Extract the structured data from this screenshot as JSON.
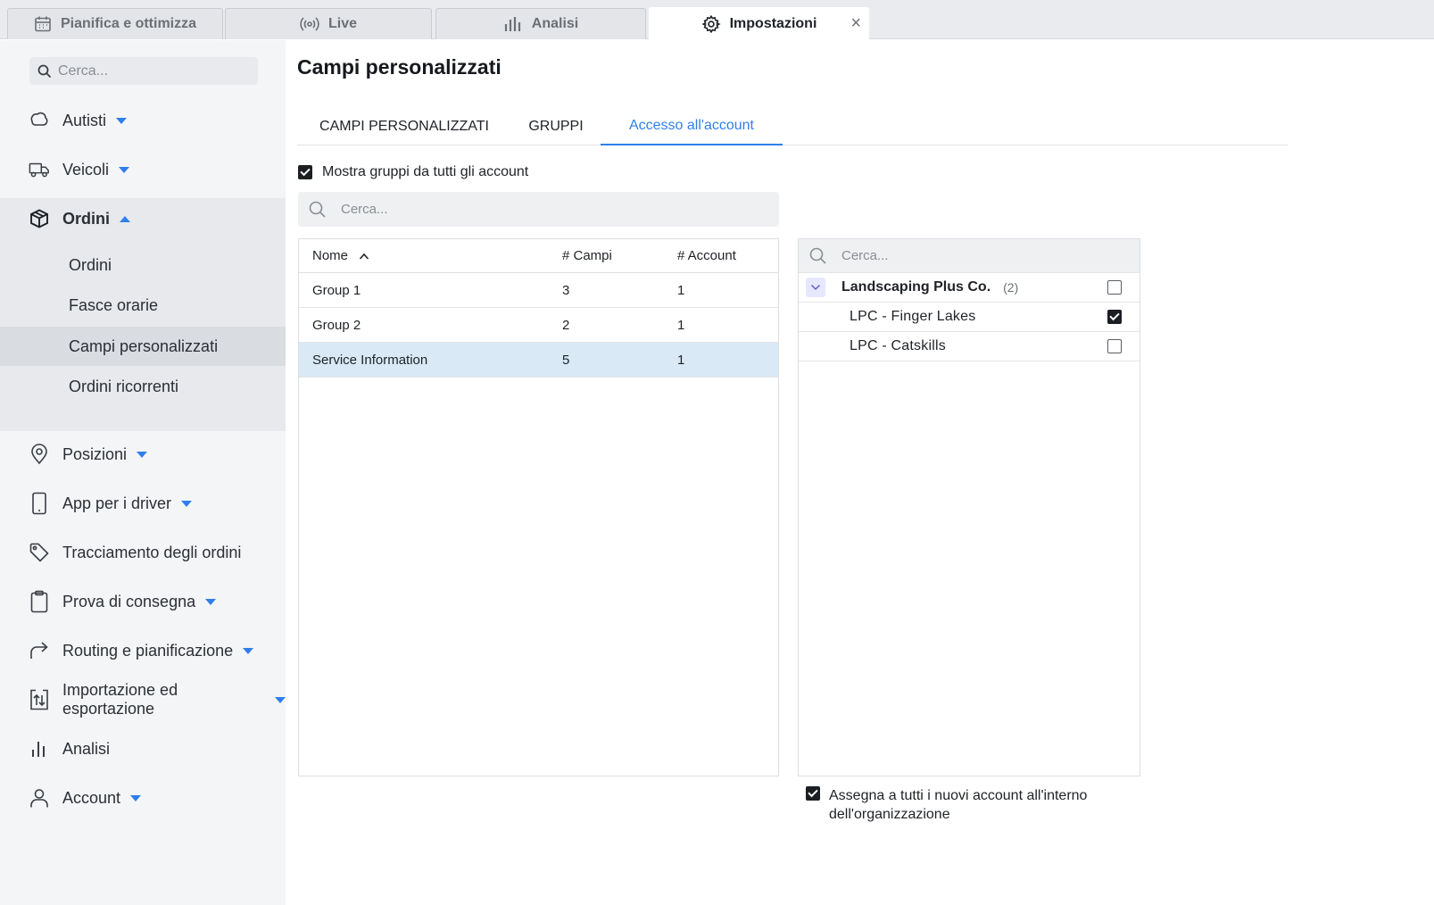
{
  "tabs": [
    {
      "label": "Pianifica e ottimizza",
      "icon": "calendar-icon"
    },
    {
      "label": "Live",
      "icon": "broadcast-icon"
    },
    {
      "label": "Analisi",
      "icon": "bar-chart-icon"
    },
    {
      "label": "Impostazioni",
      "icon": "gear-icon",
      "active": true
    }
  ],
  "tab_close": "×",
  "sidebar": {
    "search_placeholder": "Cerca...",
    "items": [
      {
        "label": "Autisti",
        "icon": "drivers-icon",
        "caret": true
      },
      {
        "label": "Veicoli",
        "icon": "truck-icon",
        "caret": true
      },
      {
        "label": "Ordini",
        "icon": "box-icon",
        "caret": "up",
        "expanded": true
      },
      {
        "label": "Posizioni",
        "icon": "location-pin-icon",
        "caret": true
      },
      {
        "label": "App per i driver",
        "icon": "phone-icon",
        "caret": true
      },
      {
        "label": "Tracciamento degli ordini",
        "icon": "tag-icon",
        "caret": false
      },
      {
        "label": "Prova di consegna",
        "icon": "clipboard-icon",
        "caret": true
      },
      {
        "label": "Routing e pianificazione",
        "icon": "route-arrow-icon",
        "caret": true
      },
      {
        "label": "Importazione ed esportazione",
        "icon": "import-export-icon",
        "caret": true
      },
      {
        "label": "Analisi",
        "icon": "bar-chart-icon",
        "caret": false
      },
      {
        "label": "Account",
        "icon": "user-icon",
        "caret": true
      }
    ],
    "sub_items": [
      "Ordini",
      "Fasce orarie",
      "Campi personalizzati",
      "Ordini ricorrenti"
    ],
    "selected_sub_item": "Campi personalizzati"
  },
  "main": {
    "title": "Campi personalizzati",
    "subtabs": [
      "CAMPI PERSONALIZZATI",
      "GRUPPI",
      "Accesso all'account"
    ],
    "active_subtab": "Accesso all'account",
    "show_all_label": "Mostra gruppi da tutti gli account",
    "show_all_checked": true,
    "search_placeholder": "Cerca...",
    "table": {
      "columns": [
        "Nome",
        "# Campi",
        "# Account"
      ],
      "rows": [
        [
          "Group 1",
          "3",
          "1"
        ],
        [
          "Group 2",
          "2",
          "1"
        ],
        [
          "Service Information",
          "5",
          "1"
        ]
      ],
      "selected_row": "Service Information"
    },
    "accounts": {
      "search_placeholder": "Cerca...",
      "group_name": "Landscaping Plus Co.",
      "group_count": "(2)",
      "group_checked": false,
      "children": [
        {
          "label": "LPC - Finger Lakes",
          "checked": true
        },
        {
          "label": "LPC - Catskills",
          "checked": false
        }
      ]
    },
    "assign_label": "Assegna a tutti i nuovi account all'interno dell'organizzazione",
    "assign_checked": true
  },
  "colors": {
    "accent": "#2f7fea",
    "selected_row": "#d9e9f5",
    "sidebar_bg": "#f4f5f7"
  }
}
